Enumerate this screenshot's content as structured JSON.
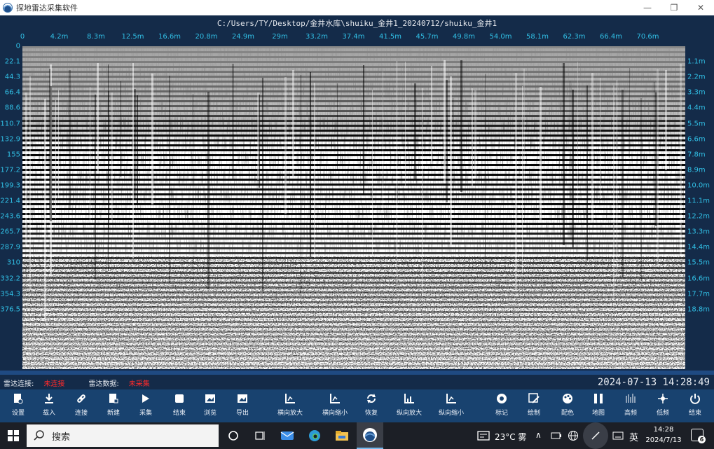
{
  "window": {
    "title": "探地雷达采集软件",
    "minimize": "—",
    "restore": "❐",
    "close": "✕"
  },
  "file_path": "C:/Users/TY/Desktop/金井水库\\shuiku_金井1_20240712/shuiku_金井1",
  "axes": {
    "x_ticks": [
      "0",
      "4.2m",
      "8.3m",
      "12.5m",
      "16.6m",
      "20.8m",
      "24.9m",
      "29m",
      "33.2m",
      "37.4m",
      "41.5m",
      "45.7m",
      "49.8m",
      "54.0m",
      "58.1m",
      "62.3m",
      "66.4m",
      "70.6m"
    ],
    "y_left_ticks": [
      "0",
      "22.1",
      "44.3",
      "66.4",
      "88.6",
      "110.7",
      "132.9",
      "155",
      "177.2",
      "199.3",
      "221.4",
      "243.6",
      "265.7",
      "287.9",
      "310",
      "332.2",
      "354.3",
      "376.5"
    ],
    "y_right_ticks": [
      "1.1m",
      "2.2m",
      "3.3m",
      "4.4m",
      "5.5m",
      "6.6m",
      "7.8m",
      "8.9m",
      "10.0m",
      "11.1m",
      "12.2m",
      "13.3m",
      "14.4m",
      "15.5m",
      "16.6m",
      "17.7m",
      "18.8m"
    ],
    "tick_color": "#31c0e6"
  },
  "status": {
    "radar_connect_label": "雷达连接:",
    "radar_connect_value": "未连接",
    "radar_data_label": "雷达数据:",
    "radar_data_value": "未采集",
    "datetime": "2024-07-13 14:28:49",
    "alert_color": "#ff2a2a"
  },
  "toolbar": [
    {
      "label": "设置",
      "icon": "settings-doc-icon"
    },
    {
      "label": "载入",
      "icon": "download-icon"
    },
    {
      "label": "连接",
      "icon": "link-icon"
    },
    {
      "label": "新建",
      "icon": "new-file-icon"
    },
    {
      "label": "采集",
      "icon": "play-icon"
    },
    {
      "label": "结束",
      "icon": "stop-icon"
    },
    {
      "label": "浏览",
      "icon": "image-browse-icon"
    },
    {
      "label": "导出",
      "icon": "export-image-icon"
    },
    {
      "label": "横向放大",
      "icon": "chart-axis-icon"
    },
    {
      "label": "横向缩小",
      "icon": "chart-axis-icon"
    },
    {
      "label": "恢复",
      "icon": "refresh-icon"
    },
    {
      "label": "纵向放大",
      "icon": "chart-bars-icon"
    },
    {
      "label": "纵向缩小",
      "icon": "chart-axis-icon"
    },
    {
      "label": "标记",
      "icon": "marker-icon"
    },
    {
      "label": "绘制",
      "icon": "draw-icon"
    },
    {
      "label": "配色",
      "icon": "palette-icon"
    },
    {
      "label": "地图",
      "icon": "map-icon"
    },
    {
      "label": "高频",
      "icon": "high-freq-icon"
    },
    {
      "label": "低频",
      "icon": "low-freq-icon"
    },
    {
      "label": "结束",
      "icon": "power-icon"
    }
  ],
  "taskbar": {
    "search_placeholder": "搜索",
    "weather": "23°C 雾",
    "ime": "英",
    "time": "14:28",
    "date": "2024/7/13",
    "notifications": "6"
  }
}
